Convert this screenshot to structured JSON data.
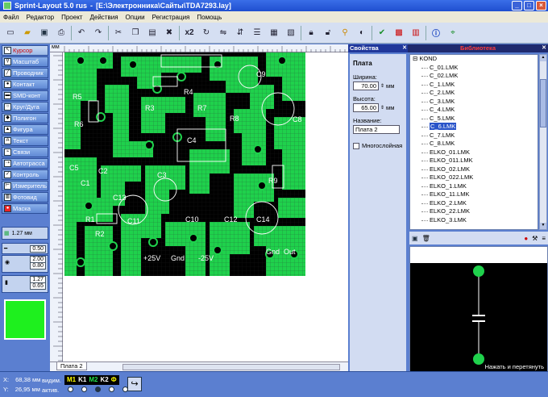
{
  "window": {
    "title": "Sprint-Layout 5.0 rus",
    "path": "[E:\\Электронника\\Сайты\\TDA7293.lay]",
    "btn_min": "_",
    "btn_max": "□",
    "btn_close": "×"
  },
  "menu": [
    "Файл",
    "Редактор",
    "Проект",
    "Действия",
    "Опции",
    "Регистрация",
    "Помощь"
  ],
  "toolbar": {
    "scale_label": "x2",
    "icons": [
      "new-icon",
      "open-icon",
      "save-icon",
      "print-icon",
      "undo-icon",
      "redo-icon",
      "cut-icon",
      "copy-icon",
      "paste-icon",
      "delete-icon",
      "scale-icon",
      "rotate-icon",
      "mirror-h-icon",
      "mirror-v-icon",
      "align-icon",
      "group-icon",
      "ungroup-icon",
      "lock-icon",
      "unlock-icon",
      "zoom-icon",
      "autoroute-icon",
      "drc-icon",
      "info-icon",
      "grid-icon"
    ]
  },
  "tools": [
    {
      "label": "Курсор",
      "active": true
    },
    {
      "label": "Масштаб",
      "active": false
    },
    {
      "label": "Проводник",
      "active": false
    },
    {
      "label": "Контакт",
      "active": false
    },
    {
      "label": "SMD-конт",
      "active": false
    },
    {
      "label": "Круг/Дуга",
      "active": false
    },
    {
      "label": "Полигон",
      "active": false
    },
    {
      "label": "Фигура",
      "active": false
    },
    {
      "label": "Текст",
      "active": false
    },
    {
      "label": "Связи",
      "active": false
    },
    {
      "label": "Автотрасса",
      "active": false
    },
    {
      "label": "Контроль",
      "active": false
    },
    {
      "label": "Измеритель",
      "active": false
    },
    {
      "label": "Фотовид",
      "active": false
    },
    {
      "label": "Маска",
      "active": false
    }
  ],
  "sizes": {
    "grid": "1.27 мм",
    "track": "0.50",
    "pad_outer": "2.00",
    "pad_inner": "0.80",
    "smd_w": "1.27",
    "smd_h": "0.65"
  },
  "colors": {
    "copper": "#1fd14c",
    "board": "#000000",
    "panel": "#5b7fd0"
  },
  "ruler": {
    "unit": "мм"
  },
  "board_labels": [
    "R5",
    "R6",
    "R3",
    "R4",
    "R7",
    "R8",
    "C9",
    "C8",
    "C5",
    "C2",
    "C1",
    "C3",
    "C4",
    "R9",
    "R1",
    "R2",
    "C11",
    "C10",
    "C12",
    "C14",
    "C13",
    "+25V",
    "Gnd",
    "-25V",
    "Gnd",
    "Out"
  ],
  "tabs": {
    "board2": "Плата 2"
  },
  "properties": {
    "header": "Свойства",
    "section": "Плата",
    "width_label": "Ширина:",
    "width_value": "70.00",
    "height_label": "Высота:",
    "height_value": "65.00",
    "unit": "мм",
    "name_label": "Название:",
    "name_value": "Плата 2",
    "multilayer_label": "Многослойная"
  },
  "library": {
    "header": "Библиотека",
    "root": "KOND",
    "items": [
      "C_01.LMK",
      "C_02.LMK",
      "C_1.LMK",
      "C_2.LMK",
      "C_3.LMK",
      "C_4.LMK",
      "C_5.LMK",
      "C_6.LMK",
      "C_7.LMK",
      "C_8.LMK",
      "ELKO_01.LMK",
      "ELKO_011.LMK",
      "ELKO_02.LMK",
      "ELKO_022.LMK",
      "ELKO_1.LMK",
      "ELKO_11.LMK",
      "ELKO_2.LMK",
      "ELKO_22.LMK",
      "ELKO_3.LMK"
    ],
    "selected": "C_6.LMK",
    "preview_hint": "Нажать и перетянуть"
  },
  "status": {
    "x_label": "X:",
    "x_value": "68,38 мм",
    "y_label": "Y:",
    "y_value": "26,95 мм",
    "visible_label": "видим.",
    "active_label": "актив.",
    "layers": [
      {
        "name": "M1",
        "color": "#ffff00"
      },
      {
        "name": "K1",
        "color": "#ffffff"
      },
      {
        "name": "M2",
        "color": "#22e24c"
      },
      {
        "name": "K2",
        "color": "#ffffff"
      },
      {
        "name": "Ф",
        "color": "#ffff00"
      }
    ]
  }
}
